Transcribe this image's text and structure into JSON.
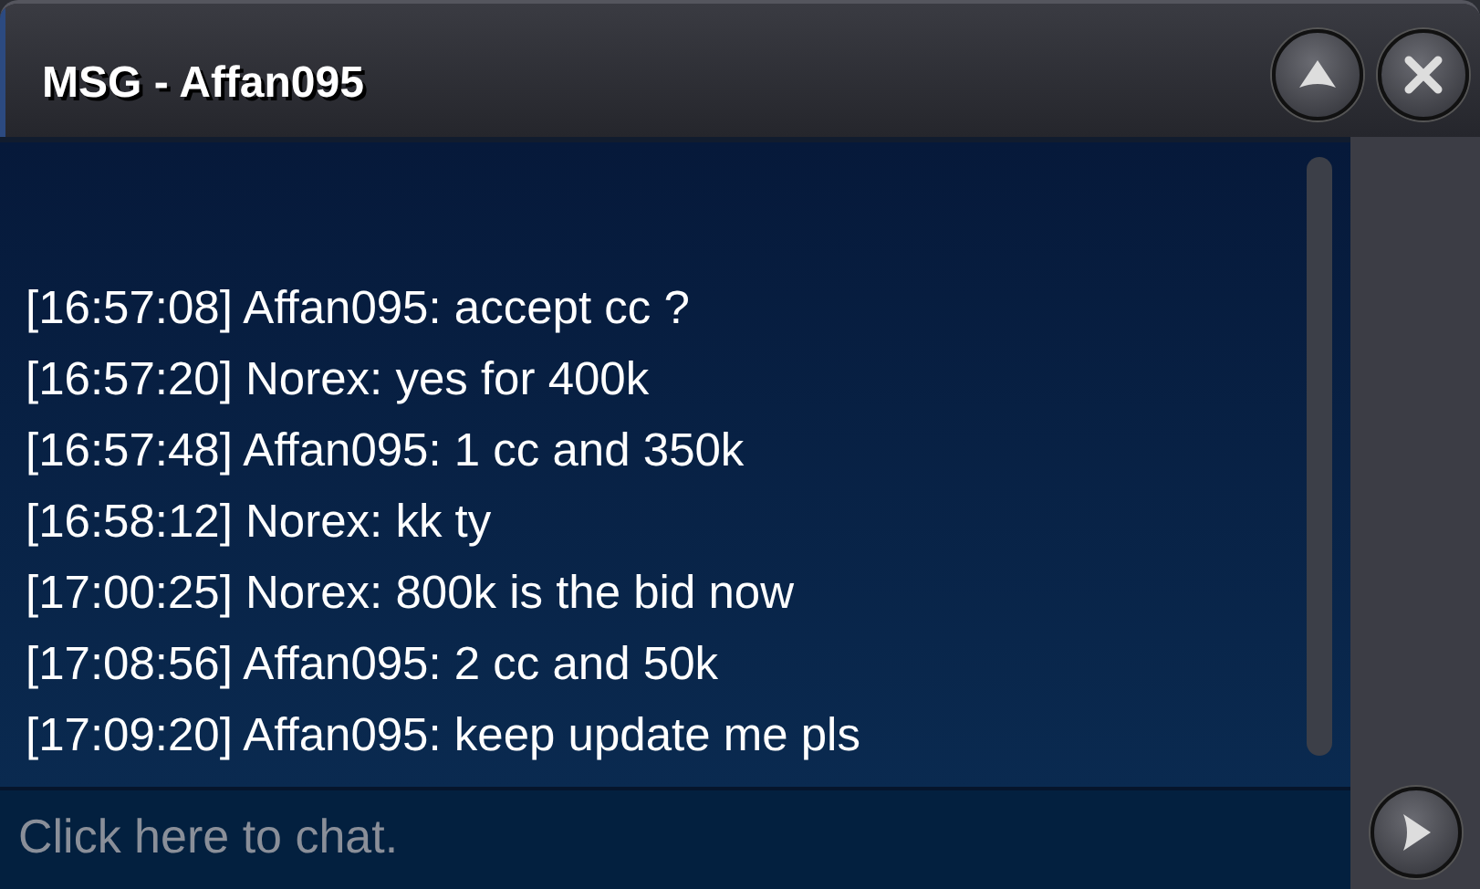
{
  "window": {
    "title": "MSG - Affan095"
  },
  "messages": [
    {
      "text": "[16:57:08] Affan095: accept cc ?"
    },
    {
      "text": "[16:57:20] Norex: yes for 400k"
    },
    {
      "text": "[16:57:48] Affan095: 1 cc and 350k"
    },
    {
      "text": "[16:58:12] Norex: kk ty"
    },
    {
      "text": "[17:00:25] Norex: 800k is the bid now"
    },
    {
      "text": "[17:08:56] Affan095: 2 cc and 50k"
    },
    {
      "text": "[17:09:20] Affan095: keep update me pls"
    }
  ],
  "input": {
    "placeholder": "Click here to chat."
  }
}
